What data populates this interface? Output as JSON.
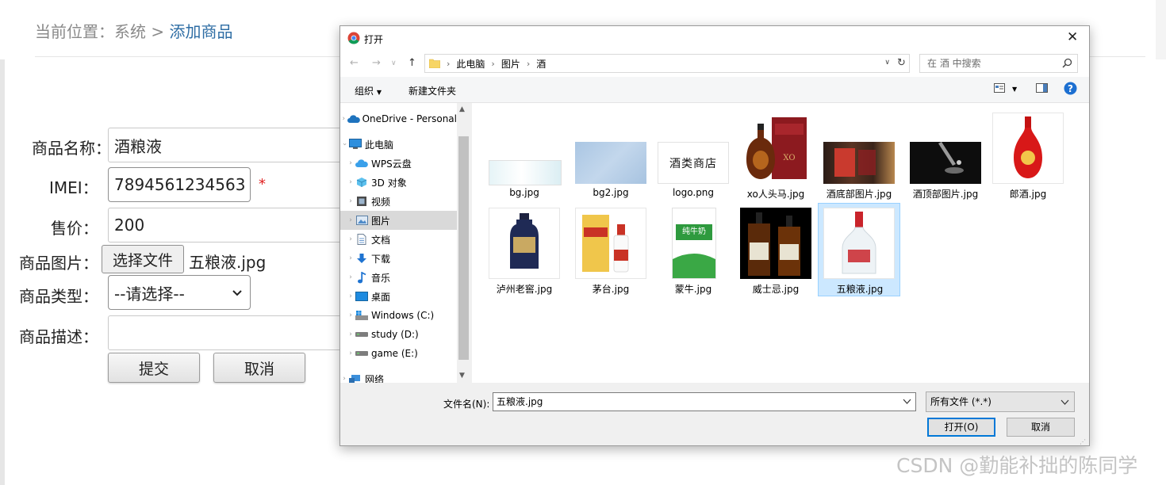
{
  "page": {
    "breadcrumb": {
      "prefix": "当前位置：",
      "section": "系统",
      "sep": ">",
      "current": "添加商品"
    },
    "form": {
      "name_label": "商品名称：",
      "name_value": "酒粮液",
      "imei_label": "IMEI：",
      "imei_value": "7894561234563",
      "required_mark": "*",
      "price_label": "售价：",
      "price_value": "200",
      "image_label": "商品图片：",
      "file_button": "选择文件",
      "file_name": "五粮液.jpg",
      "type_label": "商品类型：",
      "type_value": "--请选择--",
      "desc_label": "商品描述：",
      "desc_value": "",
      "submit": "提交",
      "cancel": "取消"
    }
  },
  "dialog": {
    "title": "打开",
    "path": [
      "此电脑",
      "图片",
      "酒"
    ],
    "search_placeholder": "在 酒 中搜索",
    "toolbar": {
      "organize": "组织",
      "new_folder": "新建文件夹"
    },
    "nav": [
      {
        "label": "OneDrive - Personal",
        "icon": "cloud-icon"
      },
      {
        "label": "此电脑",
        "icon": "computer-icon"
      },
      {
        "label": "WPS云盘",
        "icon": "wps-cloud-icon"
      },
      {
        "label": "3D 对象",
        "icon": "cube-icon"
      },
      {
        "label": "视频",
        "icon": "video-icon"
      },
      {
        "label": "图片",
        "icon": "pictures-icon",
        "selected": true
      },
      {
        "label": "文档",
        "icon": "document-icon"
      },
      {
        "label": "下载",
        "icon": "download-icon"
      },
      {
        "label": "音乐",
        "icon": "music-icon"
      },
      {
        "label": "桌面",
        "icon": "desktop-icon"
      },
      {
        "label": "Windows (C:)",
        "icon": "drive-icon"
      },
      {
        "label": "study (D:)",
        "icon": "drive-icon"
      },
      {
        "label": "game (E:)",
        "icon": "drive-icon"
      },
      {
        "label": "网络",
        "icon": "network-icon"
      }
    ],
    "files": [
      {
        "name": "bg.jpg"
      },
      {
        "name": "bg2.jpg"
      },
      {
        "name": "logo.png",
        "thumb_text": "酒类商店"
      },
      {
        "name": "xo人头马.jpg"
      },
      {
        "name": "酒底部图片.jpg"
      },
      {
        "name": "酒顶部图片.jpg"
      },
      {
        "name": "郎酒.jpg"
      },
      {
        "name": "泸州老窖.jpg"
      },
      {
        "name": "茅台.jpg"
      },
      {
        "name": "蒙牛.jpg",
        "thumb_text": "纯牛奶"
      },
      {
        "name": "威士忌.jpg"
      },
      {
        "name": "五粮液.jpg",
        "selected": true
      }
    ],
    "filename_label": "文件名(N):",
    "filename_value": "五粮液.jpg",
    "filetype_value": "所有文件 (*.*)",
    "open_button": "打开(O)",
    "cancel_button": "取消"
  },
  "watermark": "CSDN @勤能补拙的陈同学"
}
